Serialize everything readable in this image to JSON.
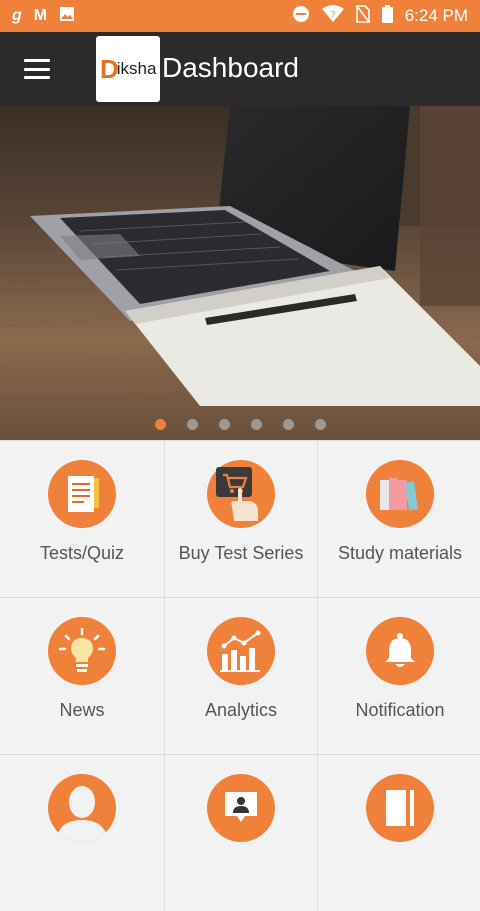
{
  "status_bar": {
    "left_icons": [
      "g-icon",
      "gmail-icon",
      "gallery-icon"
    ],
    "right_icons": [
      "do-not-disturb-icon",
      "wifi-icon",
      "no-sim-icon",
      "battery-icon"
    ],
    "time": "6:24 PM"
  },
  "app_bar": {
    "logo_letter": "D",
    "logo_text": "iksha",
    "title": "Dashboard"
  },
  "carousel": {
    "dot_count": 6,
    "active_index": 0
  },
  "grid": [
    {
      "label": "Tests/Quiz",
      "icon": "quiz-sheet-icon"
    },
    {
      "label": "Buy Test Series",
      "icon": "cart-tap-icon"
    },
    {
      "label": "Study materials",
      "icon": "books-icon"
    },
    {
      "label": "News",
      "icon": "lightbulb-icon"
    },
    {
      "label": "Analytics",
      "icon": "bar-chart-icon"
    },
    {
      "label": "Notification",
      "icon": "bell-icon"
    },
    {
      "label": "",
      "icon": "profile-icon"
    },
    {
      "label": "",
      "icon": "presenter-icon"
    },
    {
      "label": "",
      "icon": "notebook-icon"
    }
  ],
  "colors": {
    "accent": "#f0813a",
    "app_bar": "#2b2b2b",
    "grid_bg": "#f2f2f2"
  }
}
